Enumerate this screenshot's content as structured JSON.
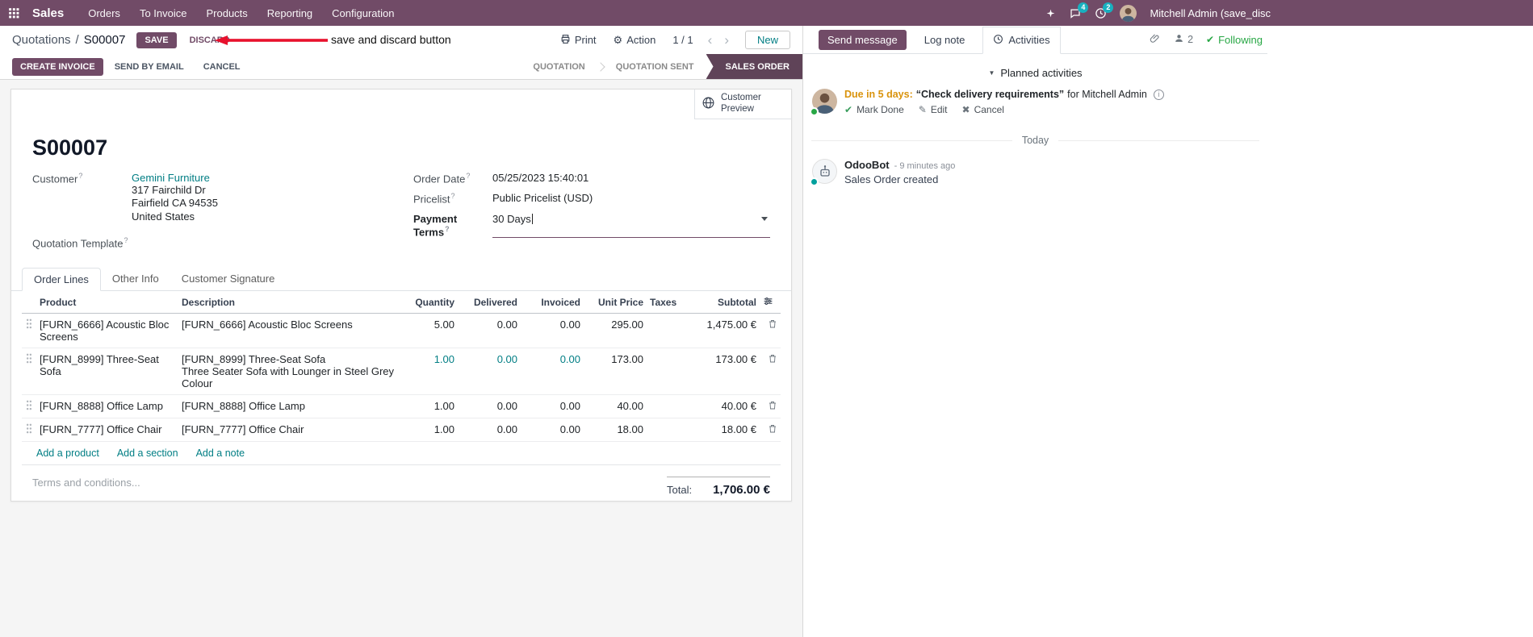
{
  "navbar": {
    "app_name": "Sales",
    "menus": [
      "Orders",
      "To Invoice",
      "Products",
      "Reporting",
      "Configuration"
    ],
    "messages_badge": "4",
    "activities_badge": "2",
    "user_name": "Mitchell Admin (save_disc"
  },
  "control_panel": {
    "breadcrumb_parent": "Quotations",
    "breadcrumb_separator": "/",
    "breadcrumb_current": "S00007",
    "save_label": "SAVE",
    "discard_label": "DISCARD",
    "annotation_text": "save and discard button",
    "print_label": "Print",
    "action_label": "Action",
    "pager_value": "1 / 1",
    "new_label": "New"
  },
  "statusbar": {
    "create_invoice_label": "CREATE INVOICE",
    "send_by_email_label": "SEND BY EMAIL",
    "cancel_label": "CANCEL",
    "states": [
      "QUOTATION",
      "QUOTATION SENT",
      "SALES ORDER"
    ],
    "active_state": "SALES ORDER"
  },
  "form": {
    "customer_preview_label": "Customer Preview",
    "title": "S00007",
    "help_marker": "?",
    "customer_label": "Customer",
    "customer_name": "Gemini Furniture",
    "address_line1": "317 Fairchild Dr",
    "address_line2": "Fairfield CA 94535",
    "address_line3": "United States",
    "quotation_template_label": "Quotation Template",
    "order_date_label": "Order Date",
    "order_date_value": "05/25/2023 15:40:01",
    "pricelist_label": "Pricelist",
    "pricelist_value": "Public Pricelist (USD)",
    "payment_terms_label": "Payment Terms",
    "payment_terms_value": "30 Days",
    "tabs": [
      "Order Lines",
      "Other Info",
      "Customer Signature"
    ],
    "order_lines": {
      "headers": [
        "Product",
        "Description",
        "Quantity",
        "Delivered",
        "Invoiced",
        "Unit Price",
        "Taxes",
        "Subtotal"
      ],
      "rows": [
        {
          "product": "[FURN_6666] Acoustic Bloc Screens",
          "description": "[FURN_6666] Acoustic Bloc Screens",
          "description_line2": "",
          "quantity": "5.00",
          "delivered": "0.00",
          "invoiced": "0.00",
          "unit_price": "295.00",
          "taxes": "",
          "subtotal": "1,475.00 €"
        },
        {
          "product": "[FURN_8999] Three-Seat Sofa",
          "description": "[FURN_8999] Three-Seat Sofa",
          "description_line2": "Three Seater Sofa with Lounger in Steel Grey Colour",
          "quantity": "1.00",
          "delivered": "0.00",
          "invoiced": "0.00",
          "unit_price": "173.00",
          "taxes": "",
          "subtotal": "173.00 €"
        },
        {
          "product": "[FURN_8888] Office Lamp",
          "description": "[FURN_8888] Office Lamp",
          "description_line2": "",
          "quantity": "1.00",
          "delivered": "0.00",
          "invoiced": "0.00",
          "unit_price": "40.00",
          "taxes": "",
          "subtotal": "40.00 €"
        },
        {
          "product": "[FURN_7777] Office Chair",
          "description": "[FURN_7777] Office Chair",
          "description_line2": "",
          "quantity": "1.00",
          "delivered": "0.00",
          "invoiced": "0.00",
          "unit_price": "18.00",
          "taxes": "",
          "subtotal": "18.00 €"
        }
      ],
      "add_product_label": "Add a product",
      "add_section_label": "Add a section",
      "add_note_label": "Add a note"
    },
    "terms_placeholder": "Terms and conditions...",
    "total_label": "Total:",
    "total_value": "1,706.00 €"
  },
  "chatter": {
    "send_message_label": "Send message",
    "log_note_label": "Log note",
    "activities_label": "Activities",
    "followers_count": "2",
    "following_label": "Following",
    "planned_activities_label": "Planned activities",
    "activity": {
      "due_text": "Due in 5 days:",
      "summary": "“Check delivery requirements”",
      "assignee_text": "for Mitchell Admin",
      "mark_done_label": "Mark Done",
      "edit_label": "Edit",
      "cancel_label": "Cancel"
    },
    "date_separator": "Today",
    "message": {
      "author": "OdooBot",
      "timestamp": "- 9 minutes ago",
      "body": "Sales Order created"
    }
  },
  "colors": {
    "brand": "#714B67",
    "link": "#017e84",
    "active_state_bg": "#5f4358",
    "annotation_red": "#e8112d",
    "activity_due": "#d9930d",
    "following_green": "#28a745"
  }
}
